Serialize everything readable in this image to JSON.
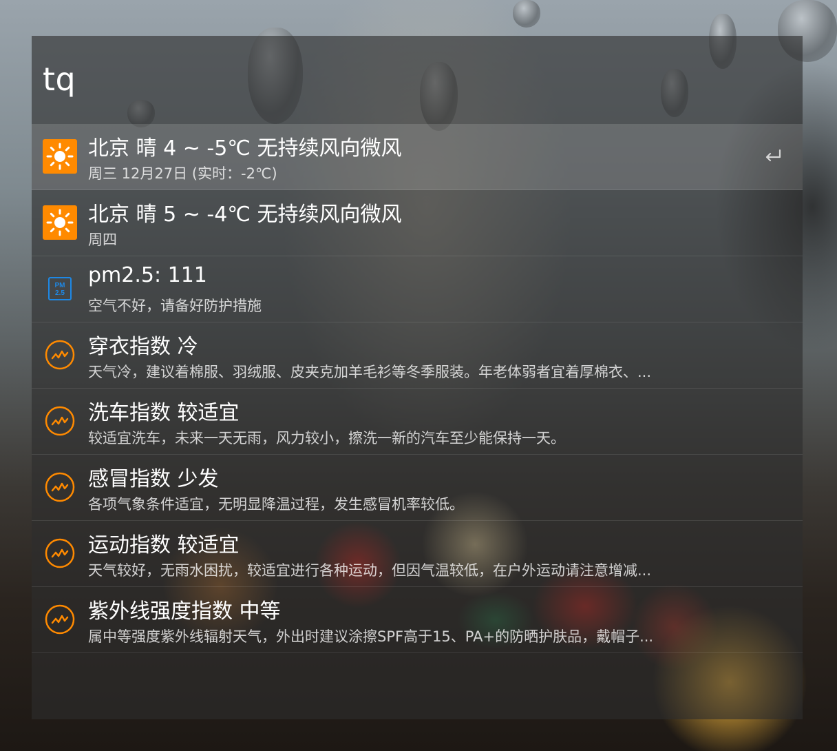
{
  "search": {
    "query": "tq"
  },
  "results": [
    {
      "icon": "sun-icon",
      "title": "北京 晴 4 ~ -5℃ 无持续风向微风",
      "subtitle": "周三 12月27日 (实时：-2℃)",
      "selected": true
    },
    {
      "icon": "sun-icon",
      "title": "北京 晴 5 ~ -4℃ 无持续风向微风",
      "subtitle": "周四"
    },
    {
      "icon": "pm25-icon",
      "title": "pm2.5: 111",
      "subtitle": "空气不好，请备好防护措施"
    },
    {
      "icon": "index-chart-icon",
      "title": "穿衣指数 冷",
      "subtitle": "天气冷，建议着棉服、羽绒服、皮夹克加羊毛衫等冬季服装。年老体弱者宜着厚棉衣、..."
    },
    {
      "icon": "index-chart-icon",
      "title": "洗车指数 较适宜",
      "subtitle": "较适宜洗车，未来一天无雨，风力较小，擦洗一新的汽车至少能保持一天。"
    },
    {
      "icon": "index-chart-icon",
      "title": "感冒指数 少发",
      "subtitle": "各项气象条件适宜，无明显降温过程，发生感冒机率较低。"
    },
    {
      "icon": "index-chart-icon",
      "title": "运动指数 较适宜",
      "subtitle": "天气较好，无雨水困扰，较适宜进行各种运动，但因气温较低，在户外运动请注意增减..."
    },
    {
      "icon": "index-chart-icon",
      "title": "紫外线强度指数 中等",
      "subtitle": "属中等强度紫外线辐射天气，外出时建议涂擦SPF高于15、PA+的防晒护肤品，戴帽子..."
    }
  ],
  "pm25_icon_text": {
    "line1": "PM",
    "line2": "2.5"
  },
  "colors": {
    "accent_orange": "#ff8a00",
    "pm_blue": "#1e88e5"
  }
}
